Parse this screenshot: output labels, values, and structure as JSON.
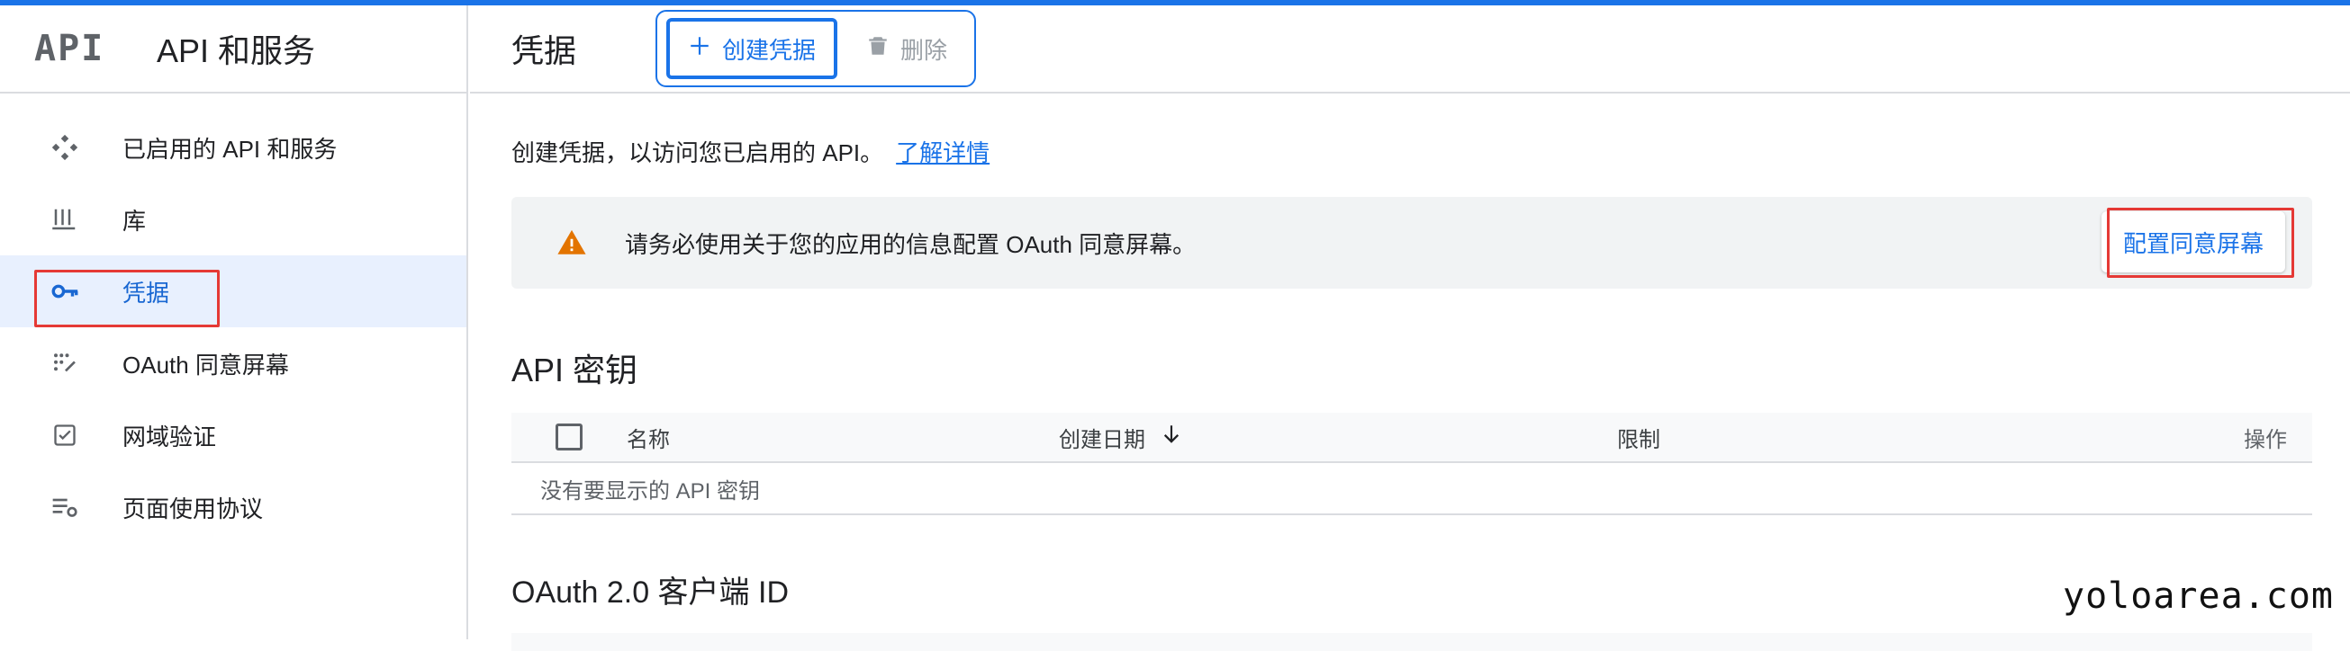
{
  "app": {
    "logo_text": "API",
    "title": "API 和服务"
  },
  "sidebar": {
    "items": [
      {
        "label": "已启用的 API 和服务",
        "icon": "api-services-icon"
      },
      {
        "label": "库",
        "icon": "library-icon"
      },
      {
        "label": "凭据",
        "icon": "key-icon",
        "active": true
      },
      {
        "label": "OAuth 同意屏幕",
        "icon": "consent-dots-icon"
      },
      {
        "label": "网域验证",
        "icon": "checkbox-verify-icon"
      },
      {
        "label": "页面使用协议",
        "icon": "settings-list-icon"
      }
    ]
  },
  "header": {
    "title": "凭据",
    "create_label": "创建凭据",
    "delete_label": "删除"
  },
  "main": {
    "intro_text": "创建凭据，以访问您已启用的 API。",
    "intro_link": "了解详情",
    "banner": {
      "text": "请务必使用关于您的应用的信息配置 OAuth 同意屏幕。",
      "action": "配置同意屏幕"
    },
    "api_keys": {
      "title": "API 密钥",
      "columns": [
        "名称",
        "创建日期",
        "限制",
        "操作"
      ],
      "empty_text": "没有要显示的 API 密钥"
    },
    "oauth": {
      "title": "OAuth 2.0 客户端 ID"
    }
  },
  "watermark": "yoloarea.com",
  "colors": {
    "accent": "#1a73e8",
    "active_bg": "#e8f0fe",
    "warning": "#e37400",
    "highlight": "#e53935"
  }
}
